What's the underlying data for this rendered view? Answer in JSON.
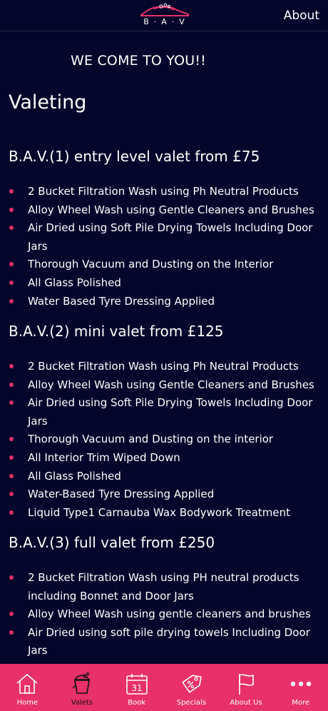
{
  "header": {
    "logo_text": "B·A·V",
    "about_label": "About"
  },
  "page": {
    "tagline": "WE COME TO YOU!!",
    "section_title": "Valeting"
  },
  "valets": [
    {
      "title": "B.A.V.(1) entry level valet from £75",
      "items": [
        "2 Bucket Filtration Wash using Ph Neutral Products",
        "Alloy Wheel Wash using Gentle Cleaners and Brushes",
        "Air Dried using Soft Pile Drying Towels Including Door Jars",
        "Thorough Vacuum and Dusting on the Interior",
        "All Glass Polished",
        "Water Based Tyre Dressing Applied"
      ]
    },
    {
      "title": "B.A.V.(2) mini valet from £125",
      "items": [
        "2 Bucket Filtration Wash using Ph Neutral Products",
        "Alloy Wheel Wash using Gentle Cleaners and Brushes",
        "Air Dried using Soft Pile Drying Towels Including Door Jars",
        "Thorough Vacuum and Dusting on the interior",
        "All Interior Trim Wiped Down",
        "All Glass Polished",
        "Water-Based Tyre Dressing Applied",
        "Liquid Type1 Carnauba Wax Bodywork Treatment"
      ]
    },
    {
      "title": "B.A.V.(3) full valet from £250",
      "items": [
        "2 Bucket Filtration Wash using PH neutral products including Bonnet and Door Jars",
        "Alloy Wheel Wash using gentle cleaners and brushes",
        "Air Dried using soft pile drying towels Including Door Jars"
      ]
    }
  ],
  "tabbar": {
    "active_tab": "Valets",
    "tabs": [
      {
        "label": "Home",
        "icon": "home-icon"
      },
      {
        "label": "Valets",
        "icon": "bucket-icon"
      },
      {
        "label": "Book",
        "icon": "calendar-icon"
      },
      {
        "label": "Specials",
        "icon": "tag-icon"
      },
      {
        "label": "About Us",
        "icon": "flag-icon"
      },
      {
        "label": "More",
        "icon": "more-icon"
      }
    ],
    "calendar_day": "31"
  },
  "colors": {
    "background": "#04052a",
    "accent": "#e8306b",
    "text": "#ffffff",
    "active_tab_text": "#111111"
  }
}
